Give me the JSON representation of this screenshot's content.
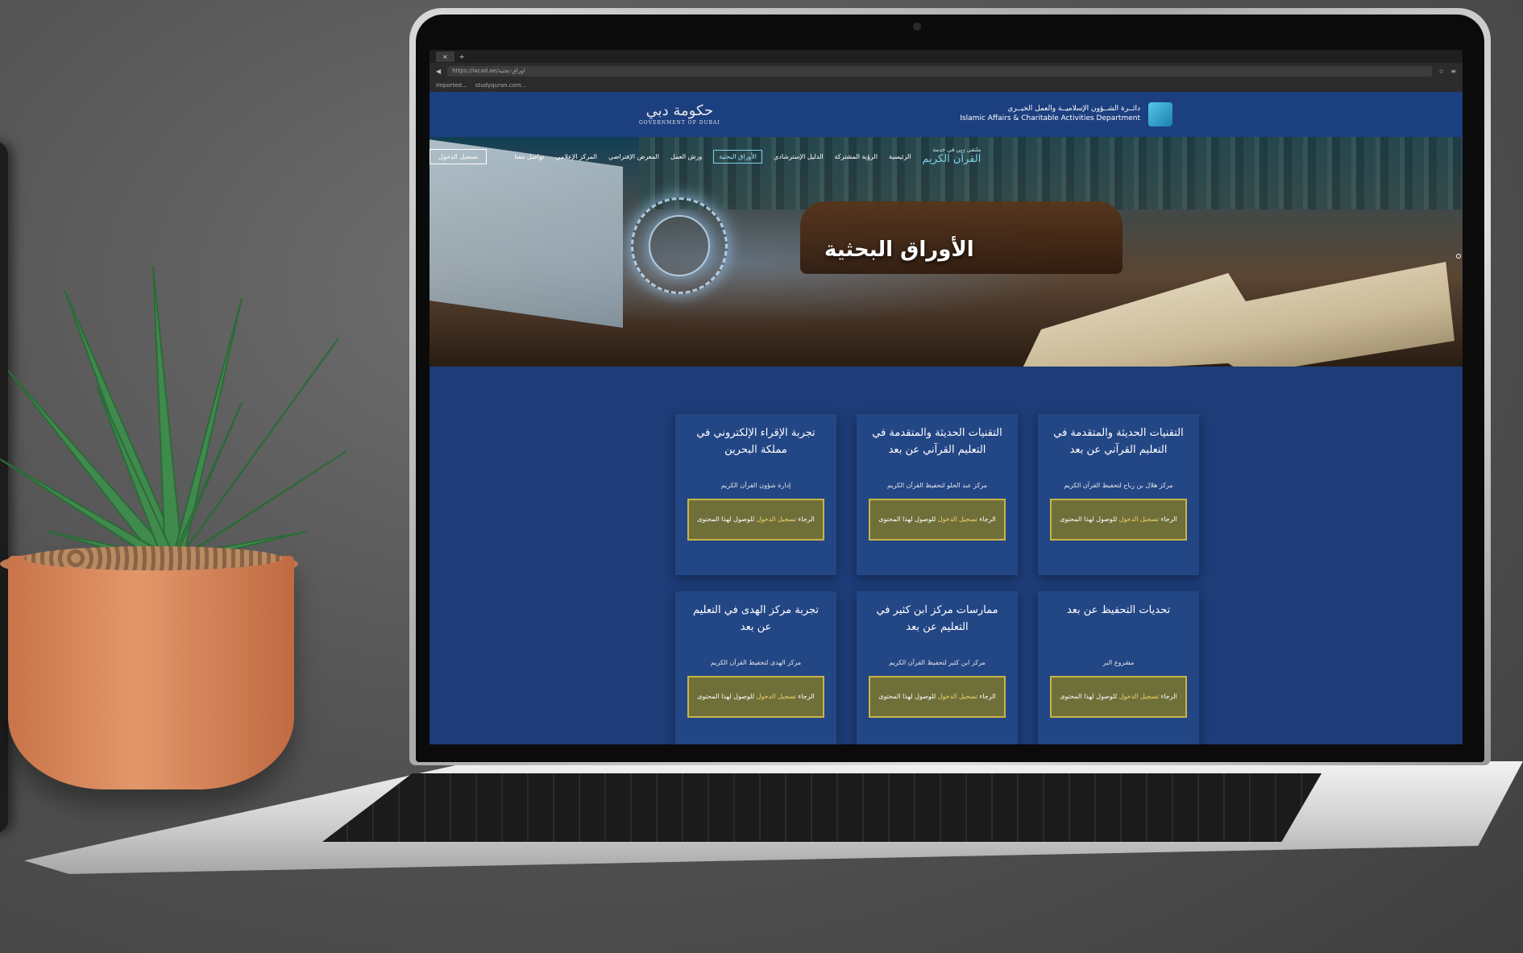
{
  "browser": {
    "tab_title": "×",
    "url": "https://iacad.ae/اوراق-بحثية",
    "bookmarks": [
      "Imported...",
      "studyquran.com..."
    ]
  },
  "header": {
    "gov_logo_ar": "حكومة دبي",
    "gov_logo_en": "GOVERNMENT OF DUBAI",
    "dept_ar": "دائــرة الشــؤون الإسلاميــة والعمل الخيــري",
    "dept_en": "Islamic Affairs & Charitable Activities Department"
  },
  "nav": {
    "brand_main": "القرآن الكريم",
    "brand_sub": "ملتقى دبي في خدمة",
    "items": [
      "الرئيسية",
      "الرؤية المشتركة",
      "الدليل الإسترشادي",
      "الأوراق البحثية",
      "ورش العمل",
      "المعرض الإفتراضي",
      "المركز الإعلامي",
      "تواصل معنا"
    ],
    "login": "تسجيل الدخول"
  },
  "hero": {
    "title": "الأوراق البحثية"
  },
  "cards": [
    {
      "title": "التقنيات الحديثة والمتقدمة في التعليم القرآني عن بعد",
      "org": "مركز هلال بن رباح لتحفيظ القرآن الكريم",
      "btn_pre": "الرجاء ",
      "btn_link": "تسجيل الدخول",
      "btn_post": " للوصول لهذا المحتوى"
    },
    {
      "title": "التقنيات الحديثة والمتقدمة في التعليم القرآني عن بعد",
      "org": "مركز عبد الحلو لتحفيظ القرآن الكريم",
      "btn_pre": "الرجاء ",
      "btn_link": "تسجيل الدخول",
      "btn_post": " للوصول لهذا المحتوى"
    },
    {
      "title": "تجربة الإقراء الإلكتروني في مملكة البحرين",
      "org": "إدارة شؤون القرآن الكريم",
      "btn_pre": "الرجاء ",
      "btn_link": "تسجيل الدخول",
      "btn_post": " للوصول لهذا المحتوى"
    },
    {
      "title": "تحديات التحفيظ عن بعد",
      "org": "مشروع البر",
      "btn_pre": "الرجاء ",
      "btn_link": "تسجيل الدخول",
      "btn_post": " للوصول لهذا المحتوى"
    },
    {
      "title": "ممارسات مركز ابن كثير في التعليم عن بعد",
      "org": "مركز ابن كثير لتحفيظ القرآن الكريم",
      "btn_pre": "الرجاء ",
      "btn_link": "تسجيل الدخول",
      "btn_post": " للوصول لهذا المحتوى"
    },
    {
      "title": "تجربة مركز الهدى في التعليم عن بعد",
      "org": "مركز الهدى لتحفيظ القرآن الكريم",
      "btn_pre": "الرجاء ",
      "btn_link": "تسجيل الدخول",
      "btn_post": " للوصول لهذا المحتوى"
    }
  ],
  "colors": {
    "page_bg": "#1d3c78",
    "card_bg": "#234685",
    "button_bg": "#6f6f3a",
    "button_border": "#c9b544",
    "accent": "#7fd0e8"
  }
}
